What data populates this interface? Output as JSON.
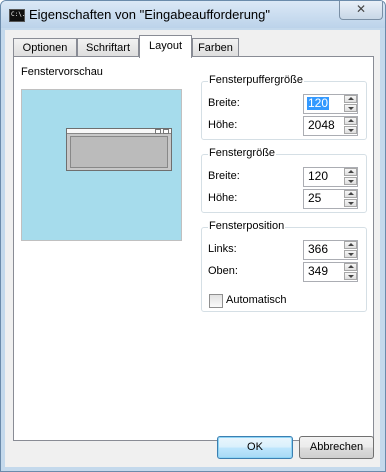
{
  "window": {
    "title": "Eigenschaften von \"Eingabeaufforderung\"",
    "icon_text": "C:\\.",
    "close_symbol": "✕"
  },
  "tabs": [
    {
      "label": "Optionen",
      "active": false
    },
    {
      "label": "Schriftart",
      "active": false
    },
    {
      "label": "Layout",
      "active": true
    },
    {
      "label": "Farben",
      "active": false
    }
  ],
  "preview": {
    "label": "Fenstervorschau"
  },
  "buffer_size": {
    "title": "Fensterpuffergröße",
    "width_label": "Breite:",
    "width_value": "120",
    "height_label": "Höhe:",
    "height_value": "2048"
  },
  "window_size": {
    "title": "Fenstergröße",
    "width_label": "Breite:",
    "width_value": "120",
    "height_label": "Höhe:",
    "height_value": "25"
  },
  "window_position": {
    "title": "Fensterposition",
    "left_label": "Links:",
    "left_value": "366",
    "top_label": "Oben:",
    "top_value": "349",
    "auto_label": "Automatisch",
    "auto_checked": false
  },
  "buttons": {
    "ok": "OK",
    "cancel": "Abbrechen"
  },
  "colors": {
    "preview_background": "#a6dcec",
    "selection": "#3399ff"
  }
}
